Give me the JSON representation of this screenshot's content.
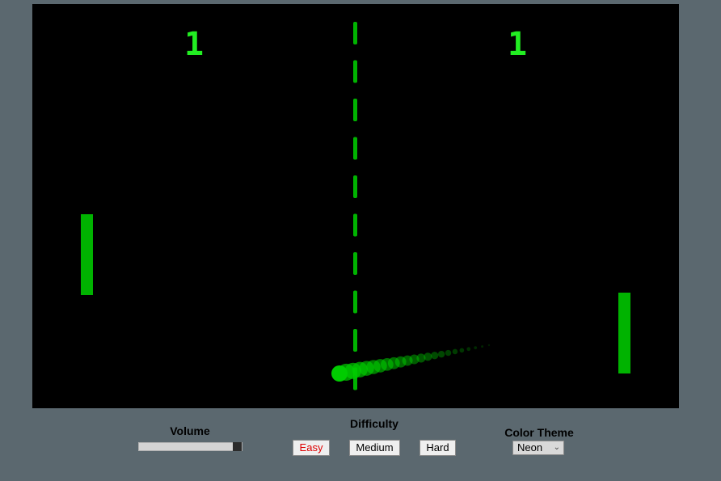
{
  "game": {
    "scores": {
      "left": "1",
      "right": "1"
    },
    "colors": {
      "background": "#000000",
      "paddle": "#00b300",
      "ball": "#00cc00",
      "net": "#00b300",
      "score": "#22ee22"
    }
  },
  "controls": {
    "volume": {
      "label": "Volume",
      "value": 0.92
    },
    "difficulty": {
      "label": "Difficulty",
      "options": [
        "Easy",
        "Medium",
        "Hard"
      ],
      "selected": "Easy",
      "selected_color": "#dd0000"
    },
    "theme": {
      "label": "Color Theme",
      "selected": "Neon",
      "icon": "chevron-down-icon"
    }
  }
}
